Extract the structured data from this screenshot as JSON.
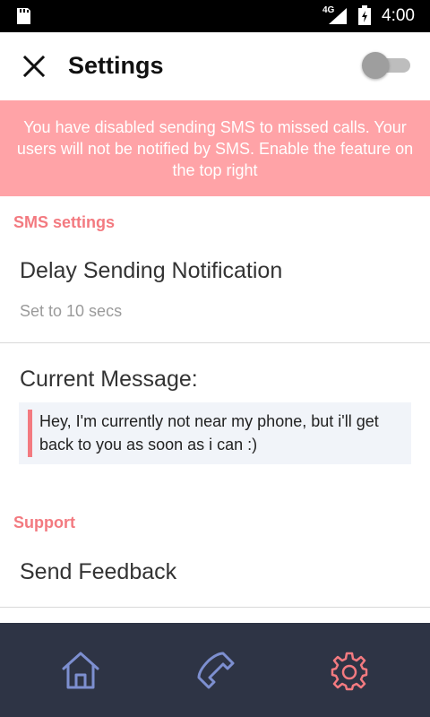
{
  "status_bar": {
    "network": "4G",
    "time": "4:00",
    "icons": [
      "sd-card-icon",
      "signal-icon",
      "battery-icon"
    ]
  },
  "app_bar": {
    "title": "Settings",
    "close_icon": "close-icon",
    "sms_toggle": {
      "state": "off"
    }
  },
  "banner": {
    "text": "You have disabled sending SMS to missed calls. Your users will not be notified by SMS. Enable the feature on the top right",
    "color": "#ffa3a7"
  },
  "sections": {
    "sms_settings": {
      "header": "SMS settings",
      "delay": {
        "title": "Delay Sending Notification",
        "subtitle": "Set to 10 secs"
      },
      "message": {
        "title": "Current Message:",
        "text": "Hey, I'm currently not near my phone, but i'll get back to you as soon as i can :)"
      }
    },
    "support": {
      "header": "Support",
      "feedback": {
        "title": "Send Feedback"
      }
    }
  },
  "bottom_nav": {
    "items": [
      {
        "icon": "home-icon",
        "active": false
      },
      {
        "icon": "phone-icon",
        "active": false
      },
      {
        "icon": "gear-icon",
        "active": true
      }
    ],
    "background": "#2e3445",
    "inactive_color": "#7d8fd0",
    "active_color": "#f37a80"
  },
  "colors": {
    "accent": "#f37a80",
    "banner": "#ffa3a7",
    "message_background": "#f1f4f9"
  }
}
